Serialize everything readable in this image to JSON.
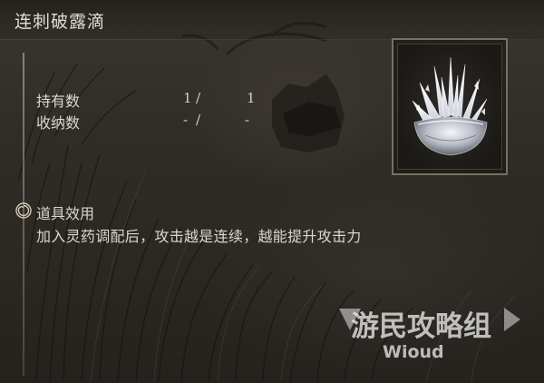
{
  "item": {
    "title": "连刺破露滴"
  },
  "stats": [
    {
      "label": "持有数",
      "current": "1",
      "separator": "/",
      "max": "1"
    },
    {
      "label": "收纳数",
      "current": "-",
      "separator": "/",
      "max": "-"
    }
  ],
  "effect": {
    "heading": "道具效用",
    "description": "加入灵药调配后，攻击越是连续，越能提升攻击力",
    "icon": "circle-swirl-icon"
  },
  "item_icon": "crystal-tear-icon",
  "watermark": {
    "logo_text": "游民攻略组",
    "sub_text": "Wioud"
  },
  "colors": {
    "text": "#ddd7ca",
    "frame": "#beb4a0",
    "background": "#2e2a25"
  }
}
